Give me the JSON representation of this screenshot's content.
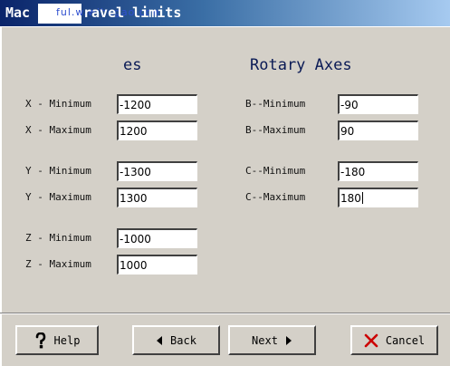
{
  "window": {
    "title_left": "Mac",
    "title_right": "ravel limits",
    "watermark": "ful.w.wjhcgao.com"
  },
  "linear": {
    "heading": "es",
    "x_min_label": "X - Minimum",
    "x_min_value": "-1200",
    "x_max_label": "X - Maximum",
    "x_max_value": "1200",
    "y_min_label": "Y - Minimum",
    "y_min_value": "-1300",
    "y_max_label": "Y - Maximum",
    "y_max_value": "1300",
    "z_min_label": "Z - Minimum",
    "z_min_value": "-1000",
    "z_max_label": "Z - Maximum",
    "z_max_value": "1000"
  },
  "rotary": {
    "heading": "Rotary Axes",
    "b_min_label": "B--Minimum",
    "b_min_value": "-90",
    "b_max_label": "B--Maximum",
    "b_max_value": "90",
    "c_min_label": "C--Minimum",
    "c_min_value": "-180",
    "c_max_label": "C--Maximum",
    "c_max_value": "180"
  },
  "buttons": {
    "help": "Help",
    "back": "Back",
    "next": "Next",
    "cancel": "Cancel"
  },
  "colors": {
    "title_gradient_start": "#0a246a",
    "title_gradient_end": "#a6caf0",
    "dialog_face": "#d4d0c8",
    "heading_text": "#0a1a55",
    "cancel_icon": "#cc0000"
  },
  "icons": {
    "help": "question-mark-icon",
    "back": "triangle-left-icon",
    "next": "triangle-right-icon",
    "cancel": "x-icon"
  }
}
